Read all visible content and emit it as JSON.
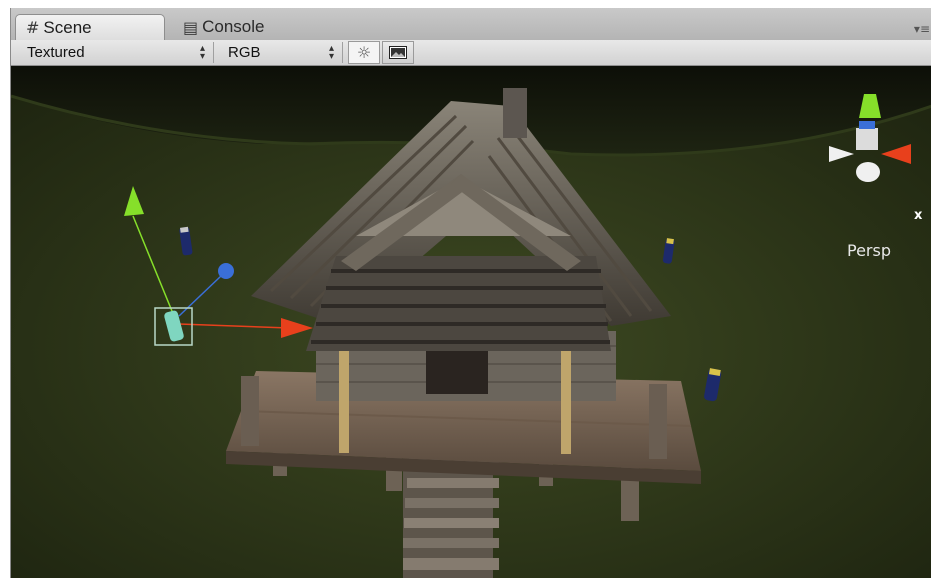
{
  "tabs": [
    {
      "label": "Scene",
      "icon": "grid-icon",
      "active": true
    },
    {
      "label": "Console",
      "icon": "console-icon",
      "active": false
    }
  ],
  "toolbar": {
    "render_mode": "Textured",
    "color_mode": "RGB",
    "lighting_toggle_icon": "sun-icon",
    "image_toggle_icon": "image-icon"
  },
  "gizmo": {
    "projection_label": "Persp",
    "x_axis_label": "x"
  },
  "colors": {
    "x_axis": "#e8401c",
    "y_axis": "#86df2a",
    "z_axis": "#3a6fd8",
    "selection": "#b8d8c8"
  }
}
